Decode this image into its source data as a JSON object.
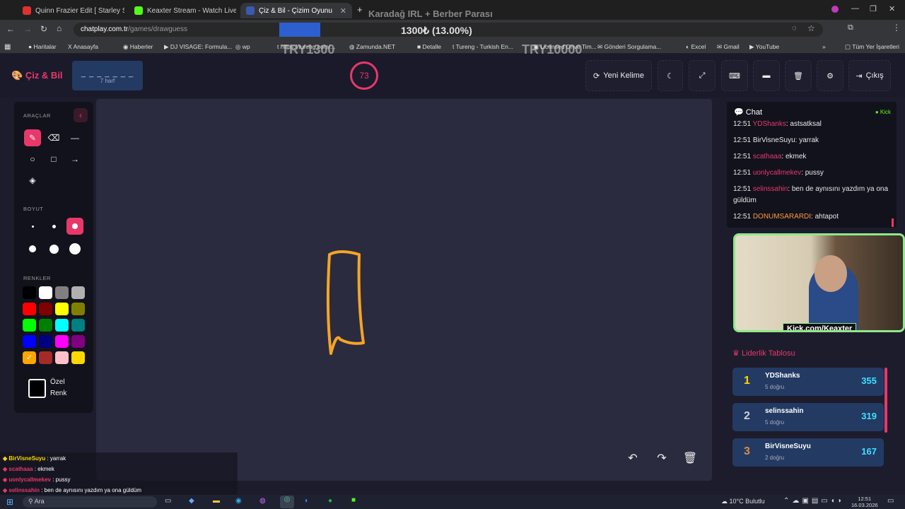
{
  "browser": {
    "tabs": [
      {
        "label": "Quinn Frazier Edit [ Starley Slow",
        "color": "#e03030"
      },
      {
        "label": "Keaxter Stream - Watch Live on",
        "color": "#53fc18"
      },
      {
        "label": "Çiz & Bil - Çizim Oyunu",
        "color": "#3a5ab0"
      }
    ],
    "stream_title": "Karadağ IRL + Berber Parası",
    "url_host": "chatplay.com.tr",
    "url_path": "/games/drawguess",
    "donation_progress": "1300₺ (13.00%)",
    "donation_progress_fraction": 0.13,
    "overlay_left": "TRY1300",
    "overlay_right": "TRY10000",
    "bookmarks": [
      "Haritalar",
      "Anasayfa",
      "Haberler",
      "DJ VISAGE: Formula...",
      "wp",
      "https://tureng.com/...",
      "Zamunda.NET",
      "Detalle",
      "Tureng - Turkish En...",
      "Licensed Drive Tim...",
      "Gönderi Sorgulama...",
      "Excel",
      "Gmail",
      "YouTube"
    ],
    "all_bookmarks": "Tüm Yer İşaretleri"
  },
  "header": {
    "logo": "Çiz & Bil",
    "word_mask": "_ _ _ _ _ _ _",
    "word_hint": "7 harf",
    "timer": "73",
    "new_word": "Yeni Kelime",
    "exit": "Çıkış"
  },
  "tools": {
    "tools_label": "ARAÇLAR",
    "size_label": "BOYUT",
    "colors_label": "RENKLER",
    "custom_color_1": "Özel",
    "custom_color_2": "Renk",
    "colors": [
      "#000000",
      "#ffffff",
      "#808080",
      "#b0b0b0",
      "#ff0000",
      "#800000",
      "#ffff00",
      "#808000",
      "#00ff00",
      "#008000",
      "#00ffff",
      "#008080",
      "#0000ff",
      "#000080",
      "#ff00ff",
      "#800080",
      "#ffa500",
      "#a52a2a",
      "#ffc0cb",
      "#ffd700"
    ],
    "selected_color": "#ffa500"
  },
  "chat": {
    "title": "Chat",
    "platform": "Kick",
    "messages": [
      {
        "time": "12:51",
        "user": "YDShanks",
        "text": "astsatksal",
        "color": "#e8386a"
      },
      {
        "time": "12:51",
        "user": "BirVisneSuyu",
        "text": "yarrak",
        "color": "#e8e8e8"
      },
      {
        "time": "12:51",
        "user": "scathaaa",
        "text": "ekmek",
        "color": "#e8386a"
      },
      {
        "time": "12:51",
        "user": "uonlycallmekev",
        "text": "pussy",
        "color": "#e8386a"
      },
      {
        "time": "12:51",
        "user": "selinssahin",
        "text": "ben de aynısını yazdım ya ona güldüm",
        "color": "#e8386a"
      },
      {
        "time": "12:51",
        "user": "DONUMSARARDI",
        "text": "ahtapot",
        "color": "#ff9a3c"
      }
    ]
  },
  "webcam": {
    "caption": "Kick.com/Keaxter"
  },
  "leaderboard": {
    "title": "Liderlik Tablosu",
    "rows": [
      {
        "rank": "1",
        "name": "YDShanks",
        "sub": "5 doğru",
        "points": "355",
        "color": "#ffd700"
      },
      {
        "rank": "2",
        "name": "selinssahin",
        "sub": "5 doğru",
        "points": "319",
        "color": "#d0d0d0"
      },
      {
        "rank": "3",
        "name": "BirVisneSuyu",
        "sub": "2 doğru",
        "points": "167",
        "color": "#e08a3c"
      }
    ]
  },
  "overlay_chat": [
    {
      "user": "BirVisneSuyu",
      "text": "yarrak",
      "color": "#ffd700"
    },
    {
      "user": "scathaaa",
      "text": "ekmek",
      "color": "#e8386a"
    },
    {
      "user": "uonlycallmekev",
      "text": "pussy",
      "color": "#e8386a"
    },
    {
      "user": "selinssahin",
      "text": "ben de aynısını yazdım ya ona güldüm",
      "color": "#e8386a"
    }
  ],
  "taskbar": {
    "search": "Ara",
    "weather": "10°C Bulutlu",
    "time": "12:51",
    "date": "16.03.2026"
  }
}
